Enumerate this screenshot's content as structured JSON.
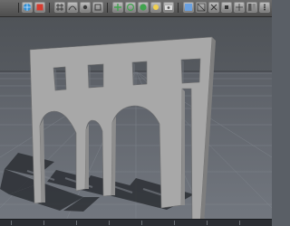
{
  "toolbar": {
    "buttons": [
      {
        "icon": "render-globe-icon",
        "color": "#2f8fd6"
      },
      {
        "icon": "render-settings-icon",
        "color": "#d63b2f"
      },
      {
        "icon": "snap-grid-icon",
        "color": "#7a7a7a"
      },
      {
        "icon": "move-tool-icon",
        "color": "#3fa34d"
      },
      {
        "icon": "rotate-tool-icon",
        "color": "#6aa0e0"
      },
      {
        "icon": "camera-icon",
        "color": "#e0e0e0"
      },
      {
        "icon": "light-icon",
        "color": "#f0d050"
      },
      {
        "icon": "display-mode-icon",
        "color": "#9a9a9a"
      }
    ]
  },
  "viewport": {
    "background_top": "#56595e",
    "background_bottom": "#6a6f76",
    "grid_color": "#8a9098",
    "wall_color": "#a7a7a7",
    "wall_edge_color": "#6d6d6d",
    "shadow_color": "#2c2f34"
  }
}
